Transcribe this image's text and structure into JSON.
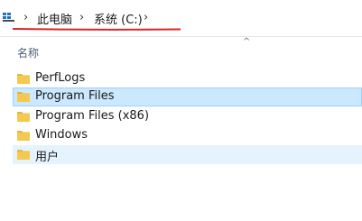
{
  "breadcrumb": {
    "items": [
      "此电脑",
      "系统 (C:)"
    ],
    "separator": "›"
  },
  "file_list": {
    "column_header": "名称",
    "rows": [
      {
        "name": "PerfLogs",
        "state": "normal"
      },
      {
        "name": "Program Files",
        "state": "selected"
      },
      {
        "name": "Program Files (x86)",
        "state": "normal"
      },
      {
        "name": "Windows",
        "state": "normal"
      },
      {
        "name": "用户",
        "state": "hovered"
      }
    ]
  },
  "colors": {
    "annotation_underline": "#d9262b",
    "selection_fill": "#cce8ff",
    "selection_border": "#99d1ff",
    "hover_fill": "#e5f3ff",
    "folder": "#f4c94f"
  },
  "icons": [
    "this-pc-icon",
    "chevron-right-icon",
    "sort-up-icon",
    "folder-icon"
  ]
}
